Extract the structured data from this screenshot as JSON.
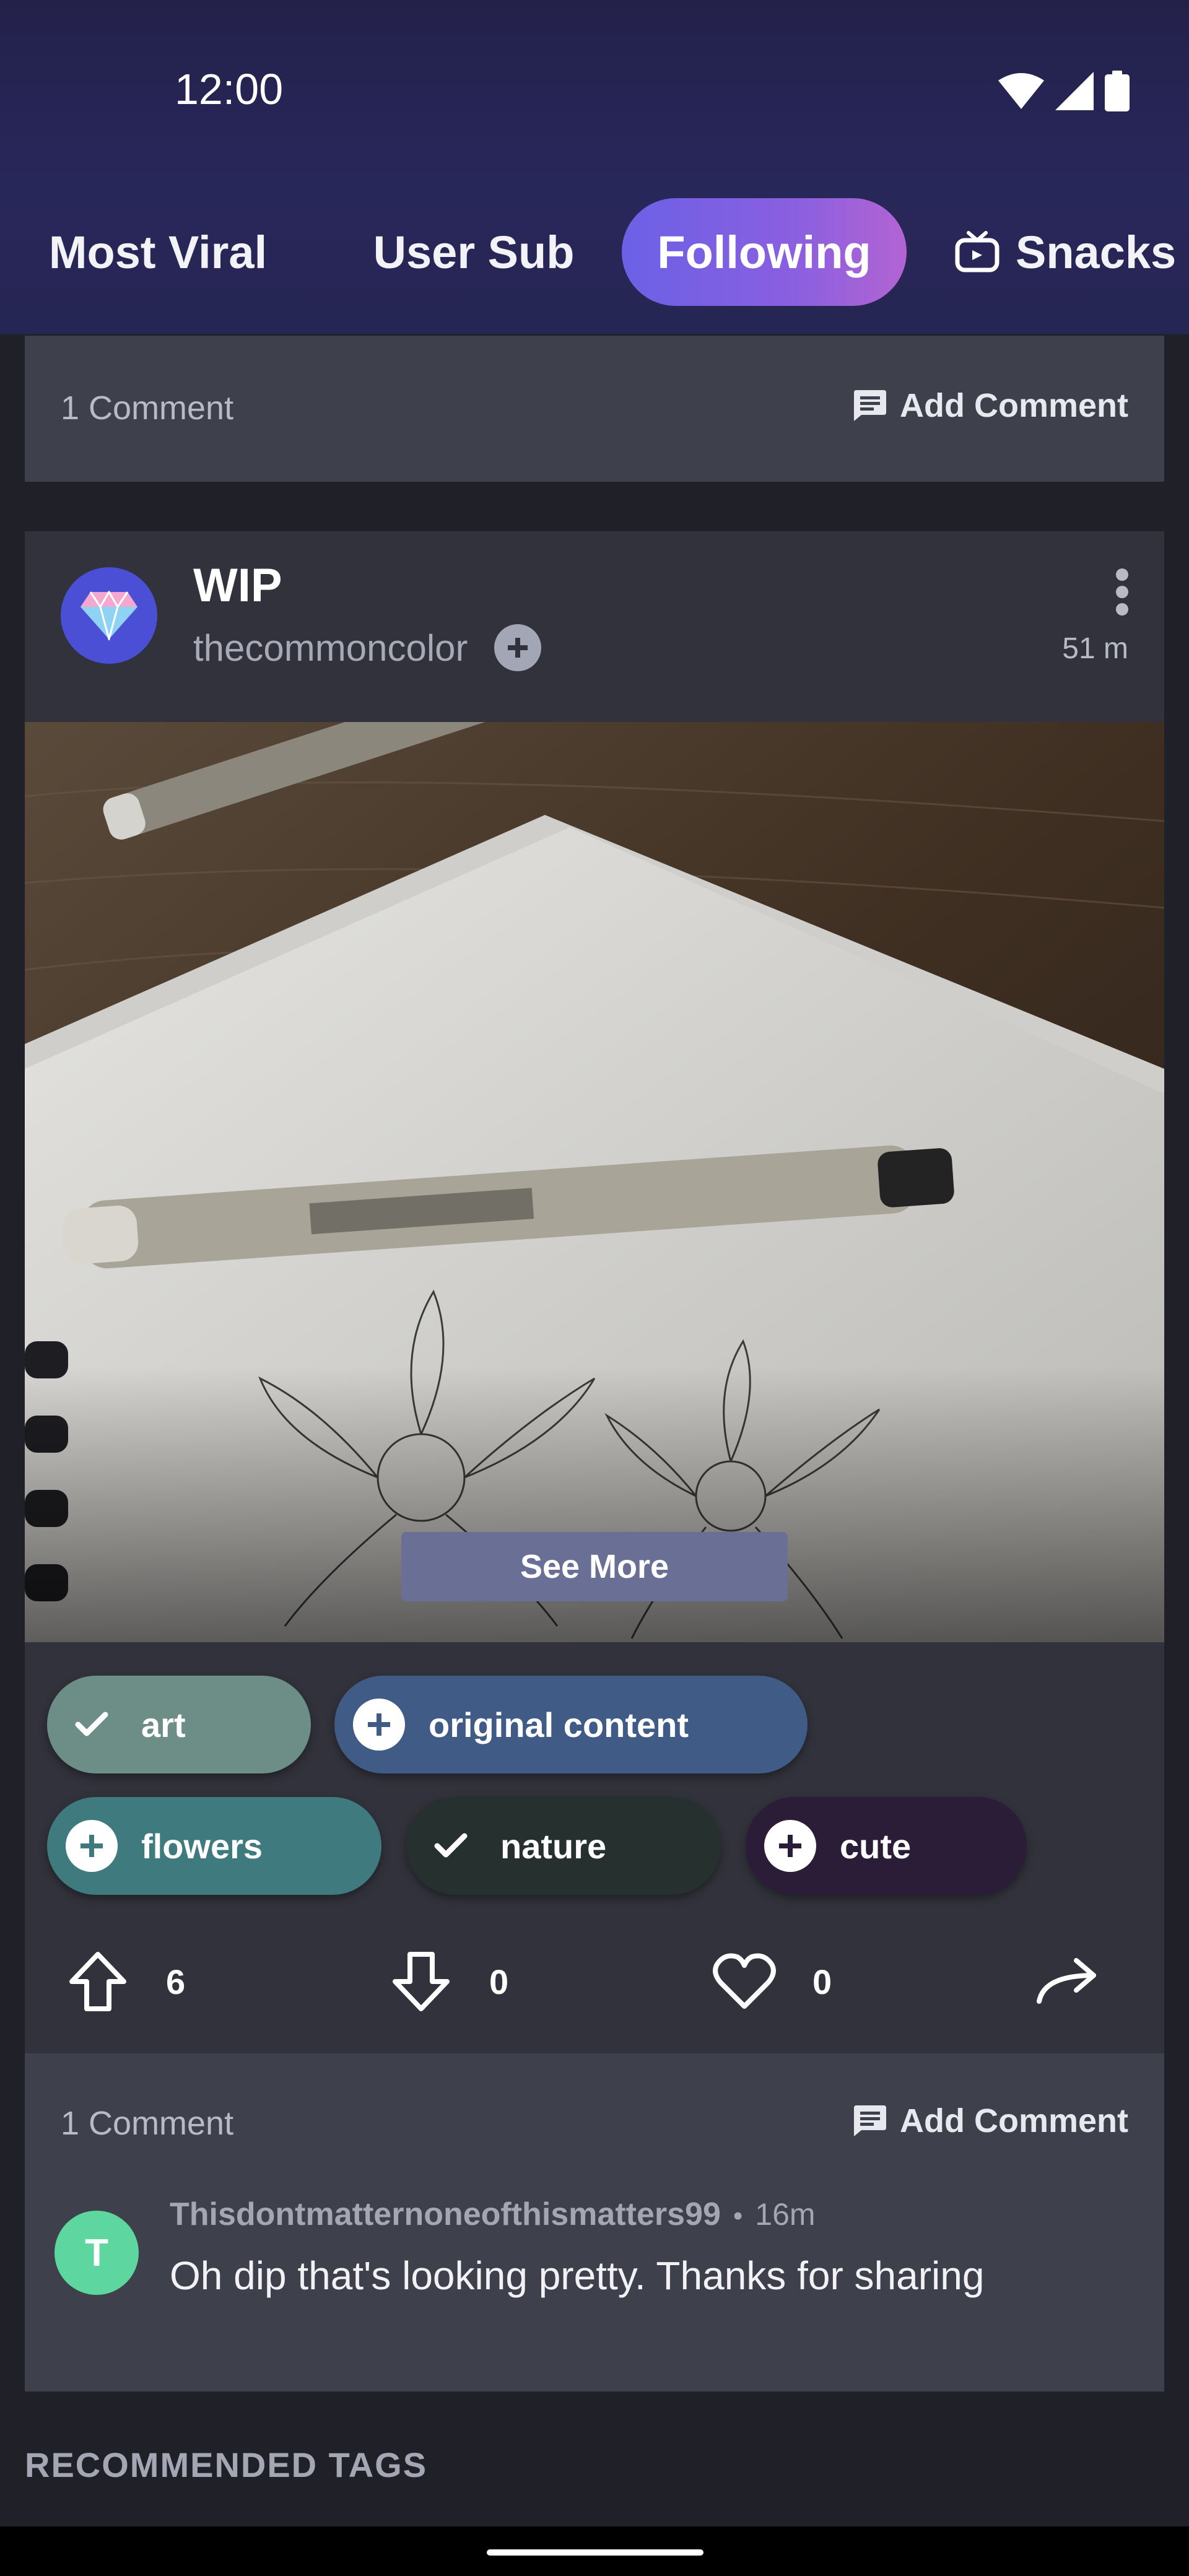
{
  "status": {
    "time": "12:00"
  },
  "tabs": [
    {
      "label": "Most Viral"
    },
    {
      "label": "User Sub"
    },
    {
      "label": "Following"
    },
    {
      "label": "Snacks"
    }
  ],
  "prev_post": {
    "comment_count": "1 Comment",
    "add_comment": "Add Comment"
  },
  "post": {
    "title": "WIP",
    "author": "thecommoncolor",
    "time_ago": "51 m",
    "see_more": "See More",
    "tags": [
      {
        "label": "art",
        "following": true
      },
      {
        "label": "original content",
        "following": false
      },
      {
        "label": "flowers",
        "following": false
      },
      {
        "label": "nature",
        "following": true
      },
      {
        "label": "cute",
        "following": false
      }
    ],
    "upvotes": "6",
    "downvotes": "0",
    "favorites": "0",
    "comments": {
      "count_label": "1 Comment",
      "add_comment": "Add Comment",
      "items": [
        {
          "avatar_letter": "T",
          "username": "Thisdontmatternoneofthismatters99",
          "separator": "•",
          "time_ago": "16m",
          "text": "Oh dip that's looking pretty. Thanks for sharing"
        }
      ]
    }
  },
  "recommended": {
    "heading": "RECOMMENDED TAGS"
  },
  "colors": {
    "header_bg": "#262653",
    "active_tab_start": "#6b61e6",
    "active_tab_end": "#b264d2",
    "card_bg": "#31323b",
    "comment_bg": "#3e404b",
    "avatar_green": "#5dd6a0",
    "avatar_blue": "#4b4fd6"
  }
}
